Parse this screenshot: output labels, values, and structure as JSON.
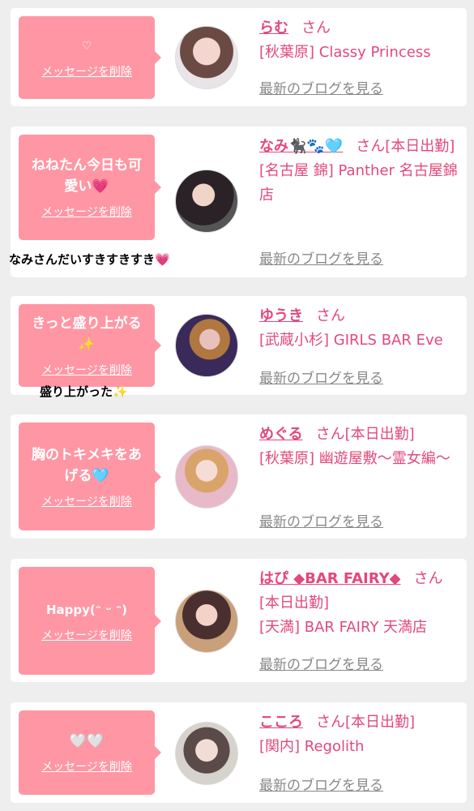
{
  "labels": {
    "delete": "メッセージを削除",
    "blog": "最新のブログを見る",
    "san": "さん"
  },
  "cards": [
    {
      "message": "♡",
      "name": "らむ",
      "status": "",
      "shop": "[秋葉原] Classy Princess"
    },
    {
      "message": "ねねたん今日も可愛い💗",
      "name": "なみ🐈‍⬛🐾🩵",
      "status": "[本日出勤]",
      "shop": "[名古屋 錦] Panther 名古屋錦店"
    },
    {
      "message": "きっと盛り上がる✨",
      "name": "ゆうき",
      "status": "",
      "shop": "[武蔵小杉] GIRLS BAR Eve"
    },
    {
      "message": "胸のトキメキをあげる🩵",
      "name": "めぐる",
      "status": "[本日出勤]",
      "shop": "[秋葉原] 幽遊屋敷〜霊女編〜"
    },
    {
      "message": "Happy(ᵔ ᵕ ᵔ)",
      "name": "はぴ ◆BAR FAIRY◆",
      "status": "[本日出勤]",
      "shop": "[天満] BAR FAIRY 天満店"
    },
    {
      "message": "🤍🤍",
      "name": "こころ",
      "status": "[本日出勤]",
      "shop": "[関内] Regolith"
    }
  ],
  "overlays": {
    "o1": "なみさんだいすきすきすき💗",
    "o2": "盛り上がった✨"
  },
  "colors": {
    "accent": "#e2497a",
    "bubble": "#ff96a4",
    "link": "#888888"
  }
}
